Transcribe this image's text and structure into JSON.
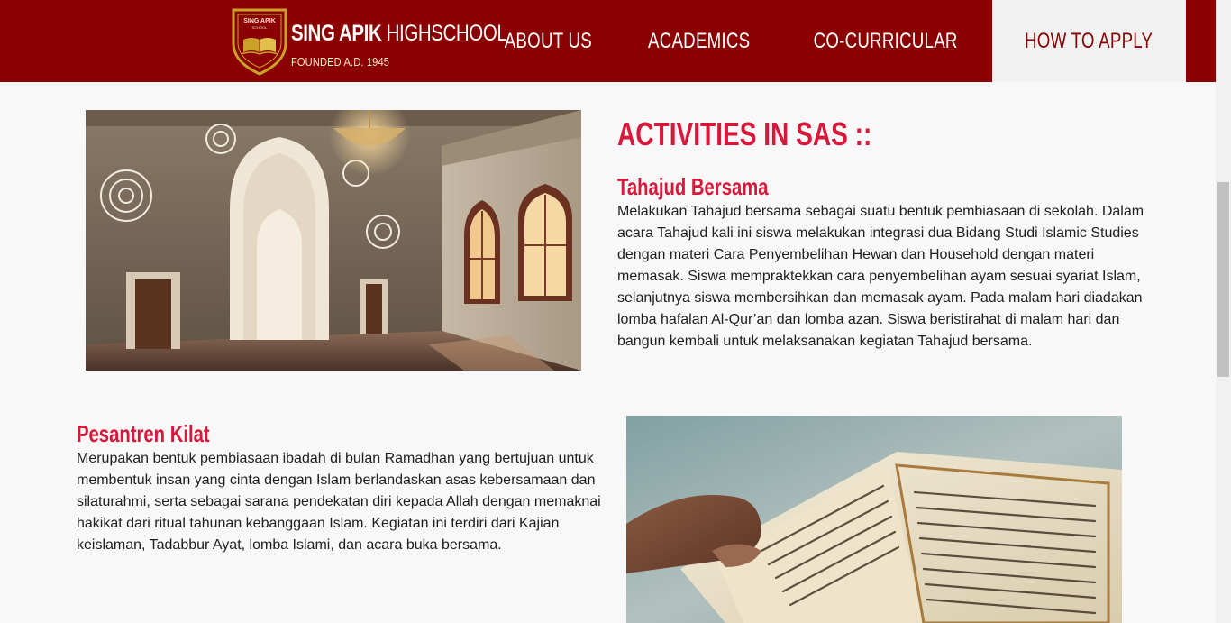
{
  "header": {
    "brand": {
      "crest_text": "SING APIK",
      "crest_sub": "SCHOOL",
      "name_bold": "SING APIK",
      "name_light": "HIGHSCHOOL",
      "founded": "FOUNDED A.D. 1945"
    },
    "nav": [
      {
        "label": "ABOUT US"
      },
      {
        "label": "ACADEMICS"
      },
      {
        "label": "CO-CURRICULAR"
      },
      {
        "label": "HOW TO APPLY",
        "active": true
      }
    ]
  },
  "content": {
    "title": "ACTIVITIES IN SAS ::",
    "activities": [
      {
        "heading": "Tahajud Bersama",
        "body": "Melakukan Tahajud bersama sebagai suatu bentuk pembiasaan di sekolah. Dalam acara Tahajud kali ini siswa melakukan integrasi dua Bidang Studi Islamic Studies dengan materi Cara Penyembelihan Hewan dan Household dengan materi memasak. Siswa mempraktekkan cara penyembelihan ayam sesuai syariat Islam, selanjutnya siswa membersihkan dan memasak ayam. Pada malam hari diadakan lomba hafalan Al-Qur’an dan lomba azan. Siswa beristirahat di malam hari dan bangun kembali untuk melaksanakan kegiatan Tahajud bersama."
      },
      {
        "heading": "Pesantren Kilat",
        "body": "Merupakan bentuk pembiasaan ibadah di bulan Ramadhan yang bertujuan untuk membentuk insan yang cinta dengan Islam berlandaskan asas kebersamaan dan silaturahmi, serta sebagai sarana pendekatan diri kepada Allah dengan memaknai hakikat dari ritual tahunan kebanggaan Islam. Kegiatan ini terdiri dari Kajian keislaman, Tadabbur Ayat, lomba Islami, dan acara buka bersama."
      }
    ]
  },
  "colors": {
    "header_bg": "#8b0000",
    "accent": "#d6183a",
    "active_nav_bg": "#f2f2f2",
    "page_bg": "#f8f8f8",
    "crest_gold": "#c9a227"
  }
}
